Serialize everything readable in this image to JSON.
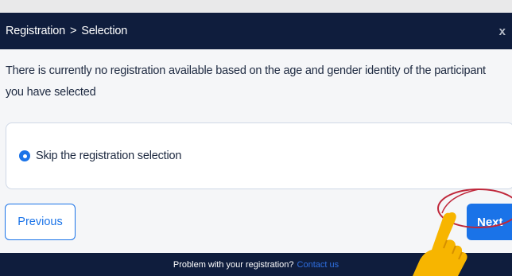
{
  "header": {
    "crumb_1": "Registration",
    "separator": ">",
    "crumb_2": "Selection",
    "close_glyph": "x"
  },
  "message": "There is currently no registration available based on the age and gender identity of the participant you have selected",
  "option": {
    "label": "Skip the registration selection",
    "selected": true
  },
  "buttons": {
    "previous": "Previous",
    "next": "Next"
  },
  "footer": {
    "text": "Problem with your registration?",
    "link": "Contact us"
  },
  "icons": [
    "close-icon",
    "radio-selected-icon",
    "pointing-hand-icon",
    "highlight-circle-icon"
  ],
  "colors": {
    "header_bg": "#0f1d3d",
    "accent": "#1a73e8",
    "hand": "#f7b500",
    "highlight": "#c0283b"
  }
}
